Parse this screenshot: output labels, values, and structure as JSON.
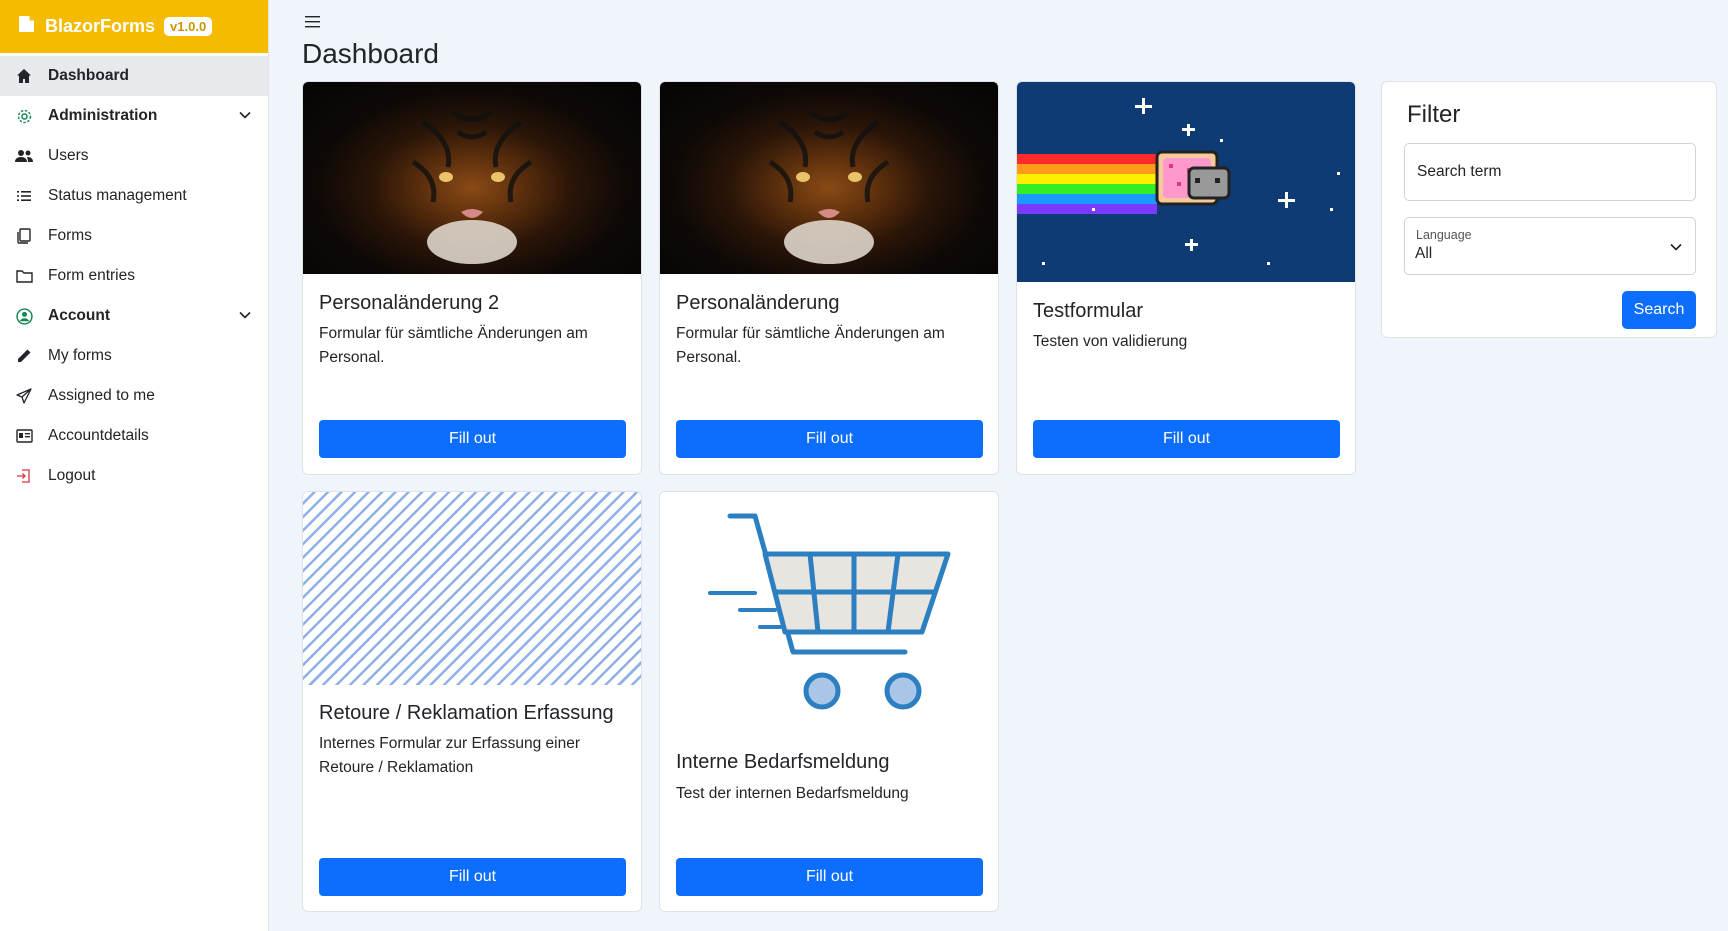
{
  "brand": {
    "title": "BlazorForms",
    "version": "v1.0.0"
  },
  "colors": {
    "brand": "#f5bb00",
    "primary": "#0d6efd",
    "active_nav": "#e7e9ec",
    "background": "#f0f4fb"
  },
  "sidebar": {
    "items": [
      {
        "label": "Dashboard",
        "icon": "home-icon"
      },
      {
        "label": "Administration",
        "icon": "gear-icon"
      },
      {
        "label": "Users",
        "icon": "users-icon"
      },
      {
        "label": "Status management",
        "icon": "list-icon"
      },
      {
        "label": "Forms",
        "icon": "copy-icon"
      },
      {
        "label": "Form entries",
        "icon": "folder-icon"
      },
      {
        "label": "Account",
        "icon": "user-circle-icon"
      },
      {
        "label": "My forms",
        "icon": "pencil-icon"
      },
      {
        "label": "Assigned to me",
        "icon": "send-icon"
      },
      {
        "label": "Accountdetails",
        "icon": "id-card-icon"
      },
      {
        "label": "Logout",
        "icon": "logout-icon"
      }
    ]
  },
  "page": {
    "title": "Dashboard"
  },
  "cards": [
    {
      "title": "Personaländerung 2",
      "description": "Formular für sämtliche Änderungen am Personal.",
      "button": "Fill out",
      "image": "tiger"
    },
    {
      "title": "Personaländerung",
      "description": "Formular für sämtliche Änderungen am Personal.",
      "button": "Fill out",
      "image": "tiger"
    },
    {
      "title": "Testformular",
      "description": "Testen von validierung",
      "button": "Fill out",
      "image": "nyan-cat"
    },
    {
      "title": "Retoure / Reklamation Erfassung",
      "description": "Internes Formular zur Erfassung einer Retoure / Reklamation",
      "button": "Fill out",
      "image": "diagonal-stripes"
    },
    {
      "title": "Interne Bedarfsmeldung",
      "description": "Test der internen Bedarfsmeldung",
      "button": "Fill out",
      "image": "shopping-cart"
    }
  ],
  "filter": {
    "title": "Filter",
    "search_placeholder": "Search term",
    "language_label": "Language",
    "language_value": "All",
    "search_button": "Search"
  }
}
